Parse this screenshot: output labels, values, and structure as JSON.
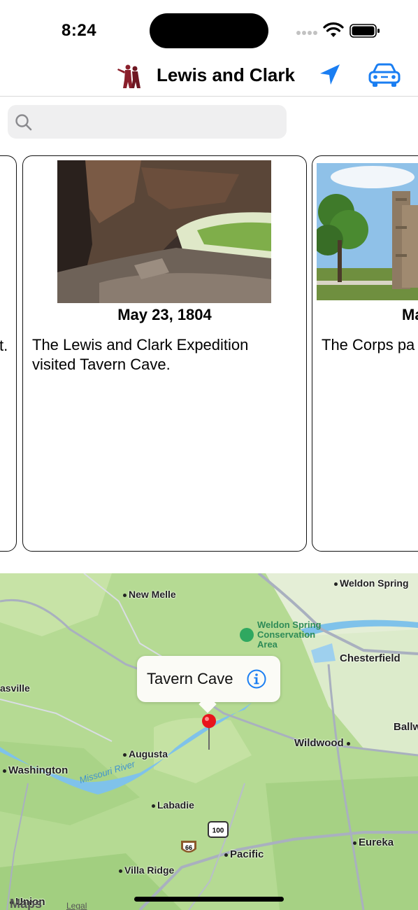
{
  "status_bar": {
    "time": "8:24"
  },
  "nav": {
    "title": "Lewis and Clark",
    "logo_icon": "lewis-clark-statue-logo",
    "location_icon": "location-arrow-icon",
    "car_icon": "car-icon",
    "accent_color": "#1a7ef2"
  },
  "search": {
    "placeholder": "",
    "value": ""
  },
  "cards": {
    "prev": {
      "tail_text": "t."
    },
    "main": {
      "date": "May 23, 1804",
      "description": "The Lewis and Clark Expedition visited Tavern Cave."
    },
    "next": {
      "date": "Ma",
      "description": "The Corps pa Settlement."
    }
  },
  "map": {
    "places": [
      {
        "id": "weldon-spring",
        "label": "Weldon Spring"
      },
      {
        "id": "new-melle",
        "label": "New Melle"
      },
      {
        "id": "chesterfield",
        "label": "Chesterfield"
      },
      {
        "id": "asville",
        "label": "asville"
      },
      {
        "id": "ballwin",
        "label": "Ballw"
      },
      {
        "id": "wildwood",
        "label": "Wildwood"
      },
      {
        "id": "augusta",
        "label": "Augusta"
      },
      {
        "id": "washington",
        "label": "Washington"
      },
      {
        "id": "labadie",
        "label": "Labadie"
      },
      {
        "id": "eureka",
        "label": "Eureka"
      },
      {
        "id": "pacific",
        "label": "Pacific"
      },
      {
        "id": "villa-ridge",
        "label": "Villa Ridge"
      },
      {
        "id": "union",
        "label": "Union"
      }
    ],
    "poi": "Weldon Spring Conservation Area",
    "river": "Missouri River",
    "callout_title": "Tavern Cave",
    "highway_66": "66",
    "highway_100": "100",
    "brand": "Maps",
    "legal": "Legal"
  }
}
